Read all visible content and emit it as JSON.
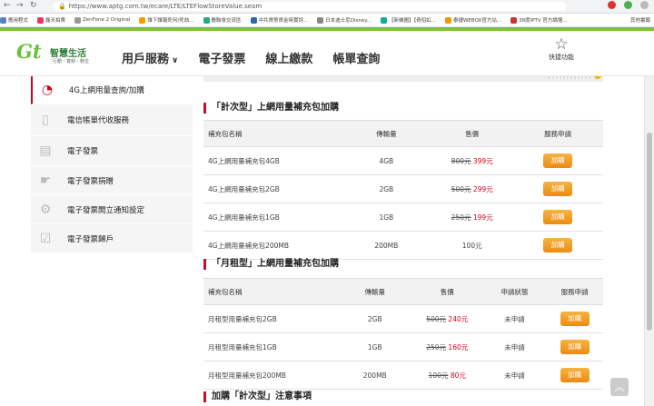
{
  "browser": {
    "url": "https://www.aptg.com.tw/ecare/LTE/LTEFlowStoreValue.seam",
    "bookmarks": [
      "應用程式",
      "露天拍賣",
      "ZenFone 2 Original",
      "誰下誰報死何/死劫...",
      "醫聯會交流區",
      "中共貨幣貨金時實評...",
      "日本迪士尼Disney...",
      "【新機圖】【奇招虹...",
      "泰捷WEBOX官方站...",
      "38度IPTV 官方論壇...",
      "其他書籤"
    ]
  },
  "header": {
    "logo_text": "Gt",
    "logo_brand": "智慧生活",
    "logo_sub": "行動・寬頻・數位",
    "nav": [
      {
        "label": "用戶服務"
      },
      {
        "label": "電子發票"
      },
      {
        "label": "線上繳款"
      },
      {
        "label": "帳單查詢"
      }
    ],
    "favorites_label": "快捷功能"
  },
  "sidebar": {
    "items": [
      {
        "label": "4G上網用量查詢/加購",
        "active": true
      },
      {
        "label": "電信帳單代收服務"
      },
      {
        "label": "電子發票"
      },
      {
        "label": "電子發票捐贈"
      },
      {
        "label": "電子發票開立通知設定"
      },
      {
        "label": "電子發票歸戶"
      }
    ]
  },
  "topup": {
    "title": "「計次型」上網用量補充包加購",
    "columns": [
      "補充包名稱",
      "傳輸量",
      "售價",
      "服務申請"
    ],
    "rows": [
      {
        "name": "4G上網用量補充包4GB",
        "volume": "4GB",
        "old_price": "800元",
        "price": "399元",
        "action": "加購"
      },
      {
        "name": "4G上網用量補充包2GB",
        "volume": "2GB",
        "old_price": "500元",
        "price": "299元",
        "action": "加購"
      },
      {
        "name": "4G上網用量補充包1GB",
        "volume": "1GB",
        "old_price": "250元",
        "price": "199元",
        "action": "加購"
      },
      {
        "name": "4G上網用量補充包200MB",
        "volume": "200MB",
        "old_price": "",
        "price": "100元",
        "action": "加購"
      }
    ]
  },
  "monthly": {
    "title": "「月租型」上網用量補充包加購",
    "columns": [
      "補充包名稱",
      "傳輸量",
      "售價",
      "申請狀態",
      "服務申請"
    ],
    "rows": [
      {
        "name": "月租型用量補充包2GB",
        "volume": "2GB",
        "old_price": "500元",
        "price": "240元",
        "status": "未申請",
        "action": "加購"
      },
      {
        "name": "月租型用量補充包1GB",
        "volume": "1GB",
        "old_price": "250元",
        "price": "160元",
        "status": "未申請",
        "action": "加購"
      },
      {
        "name": "月租型用量補充包200MB",
        "volume": "200MB",
        "old_price": "100元",
        "price": "80元",
        "status": "未申請",
        "action": "加購"
      }
    ]
  },
  "notes": {
    "title": "加購「計次型」注意事項"
  },
  "colors": {
    "brand_green": "#7cc242",
    "accent_red": "#c8102e",
    "button_orange": "#f0a020"
  }
}
